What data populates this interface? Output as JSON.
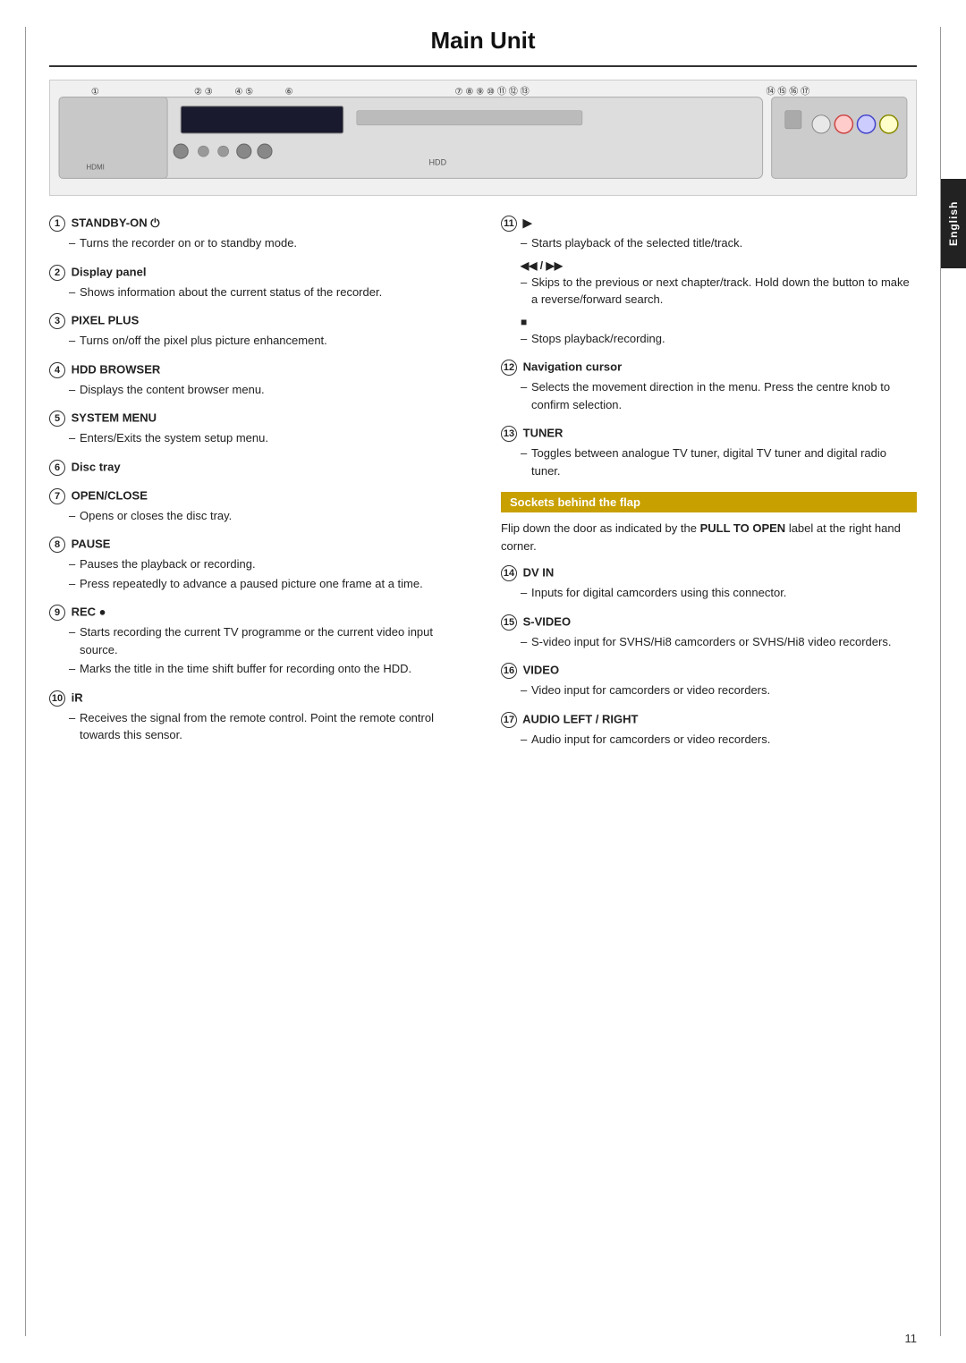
{
  "page": {
    "title": "Main Unit",
    "page_number": "11",
    "english_tab": "English"
  },
  "left_column": {
    "items": [
      {
        "num": "1",
        "title": "STANDBY-ON ⏻",
        "bullets": [
          "Turns the recorder on or to standby mode."
        ]
      },
      {
        "num": "2",
        "title": "Display panel",
        "bullets": [
          "Shows information about the current status of the recorder."
        ]
      },
      {
        "num": "3",
        "title": "PIXEL PLUS",
        "bullets": [
          "Turns on/off the pixel plus picture enhancement."
        ]
      },
      {
        "num": "4",
        "title": "HDD BROWSER",
        "bullets": [
          "Displays the content browser menu."
        ]
      },
      {
        "num": "5",
        "title": "SYSTEM MENU",
        "bullets": [
          "Enters/Exits the system setup menu."
        ]
      },
      {
        "num": "6",
        "title": "Disc tray",
        "bullets": []
      },
      {
        "num": "7",
        "title": "OPEN/CLOSE",
        "bullets": [
          "Opens or closes the disc tray."
        ]
      },
      {
        "num": "8",
        "title": "PAUSE",
        "bullets": [
          "Pauses the playback or recording.",
          "Press repeatedly to advance a paused picture one frame at a time."
        ]
      },
      {
        "num": "9",
        "title": "REC ●",
        "bullets": [
          "Starts recording the current TV programme or the current video input source.",
          "Marks the title in the time shift buffer for recording onto the HDD."
        ]
      },
      {
        "num": "10",
        "title": "iR",
        "bullets": [
          "Receives the signal from the remote control.  Point the remote control towards this sensor."
        ]
      }
    ]
  },
  "right_column": {
    "play_section": {
      "num": "11",
      "symbol": "▶",
      "bullets": [
        "Starts playback of the selected title/track."
      ],
      "sub_items": [
        {
          "symbol": "◀◀ / ▶▶",
          "bullets": [
            "Skips to the previous or next chapter/track. Hold down the button to make a reverse/forward search."
          ]
        },
        {
          "symbol": "■",
          "bullets": [
            "Stops playback/recording."
          ]
        }
      ]
    },
    "items": [
      {
        "num": "12",
        "title": "Navigation cursor",
        "bullets": [
          "Selects the movement direction in the menu. Press the centre knob to confirm selection."
        ]
      },
      {
        "num": "13",
        "title": "TUNER",
        "bullets": [
          "Toggles between analogue TV tuner, digital TV tuner and digital radio tuner."
        ]
      }
    ],
    "sockets": {
      "header": "Sockets behind the flap",
      "description": "Flip down the door as indicated by the",
      "bold_text": "PULL TO OPEN",
      "description2": "label at the right hand corner.",
      "items": [
        {
          "num": "14",
          "title": "DV IN",
          "bullets": [
            "Inputs for digital camcorders using this connector."
          ]
        },
        {
          "num": "15",
          "title": "S-VIDEO",
          "bullets": [
            "S-video input for SVHS/Hi8 camcorders or SVHS/Hi8 video recorders."
          ]
        },
        {
          "num": "16",
          "title": "VIDEO",
          "bullets": [
            "Video input for camcorders or video recorders."
          ]
        },
        {
          "num": "17",
          "title": "AUDIO LEFT / RIGHT",
          "bullets": [
            "Audio input for camcorders or video recorders."
          ]
        }
      ]
    }
  }
}
